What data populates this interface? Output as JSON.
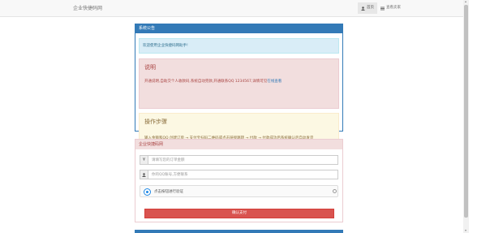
{
  "navbar": {
    "brand": "企业快捷码网",
    "home_label": "首页",
    "query_label": "查看卖家",
    "home_icon": "user-icon",
    "query_icon": "list-icon"
  },
  "notice": {
    "title": "系统公告",
    "welcome": "欢迎使用企业快捷码网助手!",
    "danger_title": "说明",
    "danger_text": "开通说明,自助交个人收款码,系统自动完款,开通联系QQ 1234567,详情可见",
    "danger_link": "在线查看",
    "warning_title": "操作步骤",
    "warning_text": "输入金额和QQ 创建订单 → 支付宝扫码二维码或点击链接跳转 → 付款 → 付款成功后系统确认后自动发货"
  },
  "order": {
    "title": "企业快捷码网",
    "amount_placeholder": "请填写您的订单金额",
    "qq_placeholder": "你的QQ账号,方便联系",
    "captcha_text": "点击按钮进行验证",
    "pay_button": "确认支付",
    "amount_icon": "yen-icon",
    "user_icon": "user-icon"
  }
}
